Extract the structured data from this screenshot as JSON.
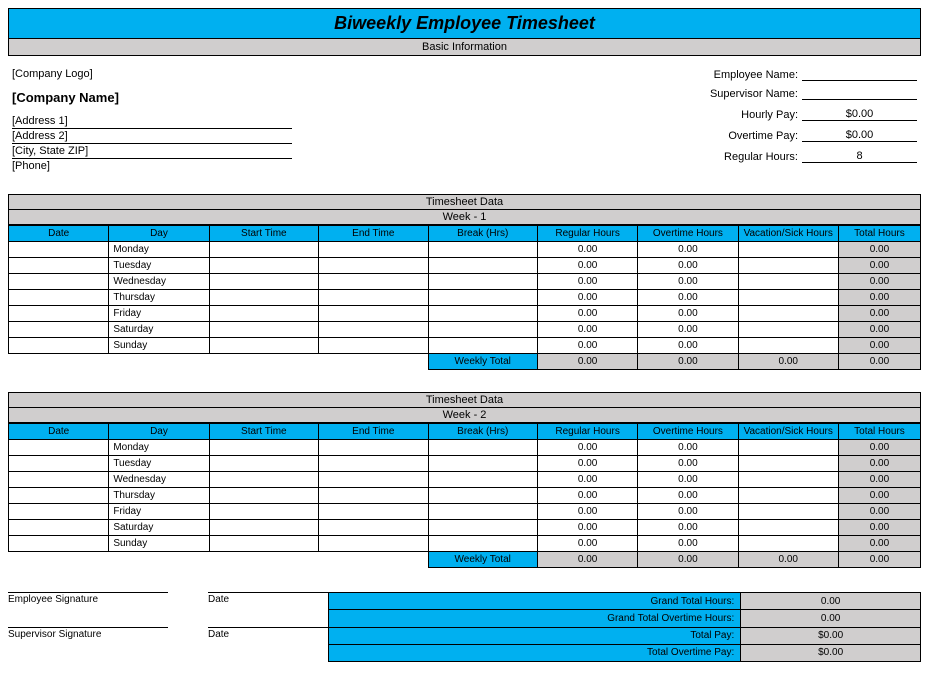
{
  "title": "Biweekly Employee Timesheet",
  "subtitle": "Basic Information",
  "company": {
    "logo": "[Company Logo]",
    "name": "[Company Name]",
    "address1": "[Address 1]",
    "address2": "[Address 2]",
    "cityzip": "[City, State ZIP]",
    "phone": "[Phone]"
  },
  "employee": {
    "name_label": "Employee Name:",
    "name_value": "",
    "supervisor_label": "Supervisor Name:",
    "supervisor_value": "",
    "hourly_pay_label": "Hourly Pay:",
    "hourly_pay_value": "$0.00",
    "overtime_pay_label": "Overtime Pay:",
    "overtime_pay_value": "$0.00",
    "regular_hours_label": "Regular Hours:",
    "regular_hours_value": "8"
  },
  "columns": {
    "date": "Date",
    "day": "Day",
    "start": "Start Time",
    "end": "End Time",
    "break": "Break (Hrs)",
    "regular": "Regular Hours",
    "overtime": "Overtime Hours",
    "vacation": "Vacation/Sick Hours",
    "total": "Total Hours"
  },
  "week1": {
    "section_label": "Timesheet Data",
    "week_label": "Week -  1",
    "days": [
      "Monday",
      "Tuesday",
      "Wednesday",
      "Thursday",
      "Friday",
      "Saturday",
      "Sunday"
    ],
    "rows": [
      {
        "regular": "0.00",
        "overtime": "0.00",
        "total": "0.00"
      },
      {
        "regular": "0.00",
        "overtime": "0.00",
        "total": "0.00"
      },
      {
        "regular": "0.00",
        "overtime": "0.00",
        "total": "0.00"
      },
      {
        "regular": "0.00",
        "overtime": "0.00",
        "total": "0.00"
      },
      {
        "regular": "0.00",
        "overtime": "0.00",
        "total": "0.00"
      },
      {
        "regular": "0.00",
        "overtime": "0.00",
        "total": "0.00"
      },
      {
        "regular": "0.00",
        "overtime": "0.00",
        "total": "0.00"
      }
    ],
    "weekly_total_label": "Weekly Total",
    "weekly_total": {
      "regular": "0.00",
      "overtime": "0.00",
      "vacation": "0.00",
      "total": "0.00"
    }
  },
  "week2": {
    "section_label": "Timesheet Data",
    "week_label": "Week -  2",
    "days": [
      "Monday",
      "Tuesday",
      "Wednesday",
      "Thursday",
      "Friday",
      "Saturday",
      "Sunday"
    ],
    "rows": [
      {
        "regular": "0.00",
        "overtime": "0.00",
        "total": "0.00"
      },
      {
        "regular": "0.00",
        "overtime": "0.00",
        "total": "0.00"
      },
      {
        "regular": "0.00",
        "overtime": "0.00",
        "total": "0.00"
      },
      {
        "regular": "0.00",
        "overtime": "0.00",
        "total": "0.00"
      },
      {
        "regular": "0.00",
        "overtime": "0.00",
        "total": "0.00"
      },
      {
        "regular": "0.00",
        "overtime": "0.00",
        "total": "0.00"
      },
      {
        "regular": "0.00",
        "overtime": "0.00",
        "total": "0.00"
      }
    ],
    "weekly_total_label": "Weekly Total",
    "weekly_total": {
      "regular": "0.00",
      "overtime": "0.00",
      "vacation": "0.00",
      "total": "0.00"
    }
  },
  "signatures": {
    "employee": "Employee Signature",
    "supervisor": "Supervisor Signature",
    "date": "Date"
  },
  "totals": {
    "grand_hours_label": "Grand Total Hours:",
    "grand_hours_value": "0.00",
    "grand_ot_label": "Grand Total Overtime Hours:",
    "grand_ot_value": "0.00",
    "total_pay_label": "Total Pay:",
    "total_pay_value": "$0.00",
    "total_ot_pay_label": "Total Overtime Pay:",
    "total_ot_pay_value": "$0.00"
  }
}
